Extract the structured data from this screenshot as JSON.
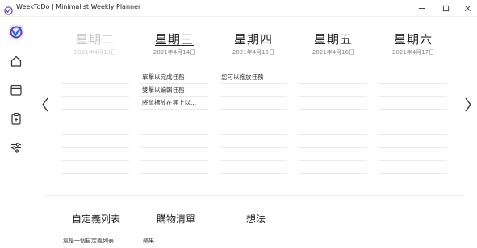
{
  "window": {
    "title": "WeekToDo | Minimalist Weekly Planner"
  },
  "sidebar": {
    "items": [
      {
        "icon": "logo-icon"
      },
      {
        "icon": "home-icon"
      },
      {
        "icon": "calendar-icon"
      },
      {
        "icon": "clipboard-icon"
      },
      {
        "icon": "settings-sliders-icon"
      }
    ]
  },
  "week": {
    "days": [
      {
        "name": "星期二",
        "date": "2021年4月13日",
        "state": "past",
        "tasks": []
      },
      {
        "name": "星期三",
        "date": "2021年4月14日",
        "state": "today",
        "tasks": [
          "單擊以完成任務",
          "雙擊以編輯任務",
          "將鼠標放在其上以..."
        ]
      },
      {
        "name": "星期四",
        "date": "2021年4月15日",
        "state": "future",
        "tasks": [
          "您可以拖放任務"
        ]
      },
      {
        "name": "星期五",
        "date": "2021年4月16日",
        "state": "future",
        "tasks": []
      },
      {
        "name": "星期六",
        "date": "2021年4月17日",
        "state": "future",
        "tasks": []
      }
    ]
  },
  "custom_lists": [
    {
      "title": "自定義列表",
      "items": [
        "這是一個自定義列表"
      ]
    },
    {
      "title": "購物清單",
      "items": [
        "蘋果"
      ]
    },
    {
      "title": "想法",
      "items": []
    }
  ]
}
